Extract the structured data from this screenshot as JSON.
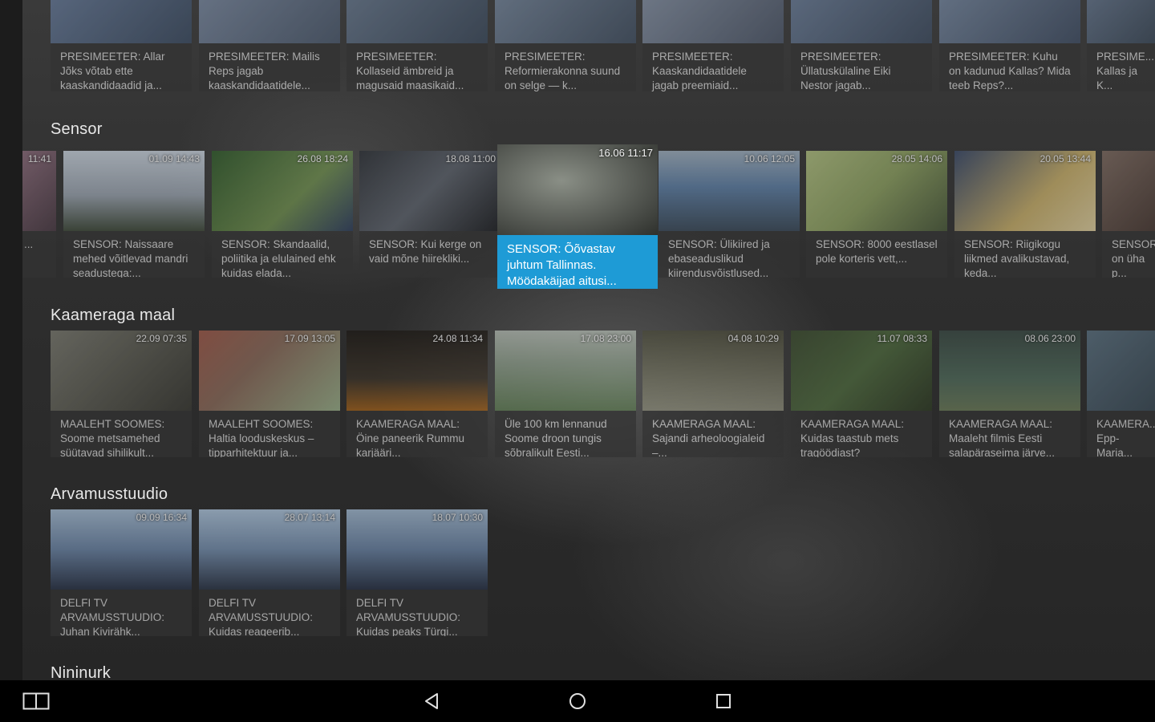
{
  "rows": [
    {
      "id": "presimeeter",
      "title": "",
      "cards": [
        {
          "time": "",
          "caption": "PRESIMEETER: Allar Jõks võtab ette kaaskandidaadid ja...",
          "color": "#6a7fa0"
        },
        {
          "time": "",
          "caption": "PRESIMEETER: Mailis Reps jagab kaaskandidaatidele...",
          "color": "#7f8fa8"
        },
        {
          "time": "",
          "caption": "PRESIMEETER: Kollaseid ämbreid ja magusaid maasikaid...",
          "color": "#6c7e95"
        },
        {
          "time": "",
          "caption": "PRESIMEETER: Reformierakonna suund on selge — k...",
          "color": "#7a8ca3"
        },
        {
          "time": "",
          "caption": "PRESIMEETER: Kaaskandidaatidele jagab preemiaid...",
          "color": "#8b98ac"
        },
        {
          "time": "",
          "caption": "PRESIMEETER: Üllatuskülaline Eiki Nestor jagab...",
          "color": "#6f83a0"
        },
        {
          "time": "",
          "caption": "PRESIMEETER: Kuhu on kadunud Kallas? Mida teeb Reps?...",
          "color": "#7b8ea8"
        },
        {
          "time": "",
          "caption": "PRESIME... Kallas ja K... valimiste ...",
          "color": "#6d7f99"
        }
      ]
    },
    {
      "id": "sensor",
      "title": "Sensor",
      "cards": [
        {
          "time": "11:41",
          "caption": "...",
          "color": "#8a6a7a"
        },
        {
          "time": "01.09 14:43",
          "caption": "SENSOR: Naissaare mehed võitlevad mandri seadustega:...",
          "color": "#9aa4b0"
        },
        {
          "time": "26.08 18:24",
          "caption": "SENSOR: Skandaalid, poliitika ja elulained ehk kuidas elada...",
          "color": "#3f6a3a"
        },
        {
          "time": "18.08 11:00",
          "caption": "SENSOR: Kui kerge on vaid mõne hiirekliki...",
          "color": "#4a4f58"
        },
        {
          "time": "16.06 11:17",
          "caption": "SENSOR: Õõvastav juhtum Tallinnas. Möödakäijad aitusi...",
          "color": "#6b6f6a"
        },
        {
          "time": "10.06 12:05",
          "caption": "SENSOR: Ülikiired ja ebaseaduslikud kiirendusvõistlused...",
          "color": "#5d7fa6"
        },
        {
          "time": "28.05 14:06",
          "caption": "SENSOR: 8000 eestlasel pole korteris vett,...",
          "color": "#8ca060"
        },
        {
          "time": "20.05 13:44",
          "caption": "SENSOR: Riigikogu liikmed avalikustavad, keda...",
          "color": "#c9b06a"
        },
        {
          "time": "",
          "caption": "SENSOR... on üha p... võitluse...",
          "color": "#7d6a60"
        }
      ]
    },
    {
      "id": "kaameraga-maal",
      "title": "Kaameraga maal",
      "cards": [
        {
          "time": "22.09 07:35",
          "caption": "MAALEHT SOOMES: Soome metsamehed süütavad sihilikult...",
          "color": "#5b5b52"
        },
        {
          "time": "17.09 13:05",
          "caption": "MAALEHT SOOMES: Haltia looduskeskus – tipparhitektuur ja...",
          "color": "#8a6a5a"
        },
        {
          "time": "24.08 11:34",
          "caption": "KAAMERAGA MAAL: Öine paneerik Rummu karjääri...",
          "color": "#3a3228"
        },
        {
          "time": "17.08 23:00",
          "caption": "Üle 100 km lennanud Soome droon tungis sõbralikult Eesti...",
          "color": "#5d7a52"
        },
        {
          "time": "04.08 10:29",
          "caption": "KAAMERAGA MAAL: Sajandi arheoloogialeid –...",
          "color": "#6a6a58"
        },
        {
          "time": "11.07 08:33",
          "caption": "KAAMERAGA MAAL: Kuidas taastub mets tragöödiast?",
          "color": "#4e6a3e"
        },
        {
          "time": "08.06 23:00",
          "caption": "KAAMERAGA MAAL: Maaleht filmis Eesti salapäraseima järve...",
          "color": "#4f6a5a"
        },
        {
          "time": "",
          "caption": "KAAMERA... Epp-Maria... maalib...",
          "color": "#5a7080"
        }
      ]
    },
    {
      "id": "arvamusstuudio",
      "title": "Arvamusstuudio",
      "cards": [
        {
          "time": "09.09 16:34",
          "caption": "DELFI TV ARVAMUSSTUUDIO: Juhan Kivirähk...",
          "color": "#6c86a8"
        },
        {
          "time": "28.07 13:14",
          "caption": "DELFI TV ARVAMUSSTUUDIO: Kuidas reageerib...",
          "color": "#7690b0"
        },
        {
          "time": "18.07 10:30",
          "caption": "DELFI TV ARVAMUSSTUUDIO: Kuidas peaks Türgi...",
          "color": "#6a84a6"
        }
      ]
    }
  ],
  "next_row_title": "Nininurk",
  "nav": {
    "left_icon": "split-screen-icon",
    "back_icon": "back-triangle-icon",
    "home_icon": "home-circle-icon",
    "recents_icon": "recents-square-icon"
  },
  "colors": {
    "accent": "#1e9bd6",
    "caption_bg": "#333333",
    "nav_bg": "#000000"
  }
}
